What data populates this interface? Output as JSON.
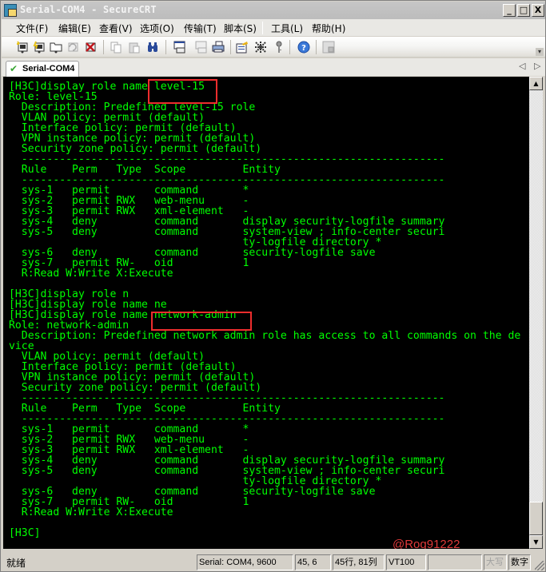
{
  "window": {
    "title": "Serial-COM4 - SecureCRT",
    "controls": {
      "minimize": "_",
      "maximize": "□",
      "close": "X"
    }
  },
  "menu": {
    "items": [
      {
        "label": "文件(F)"
      },
      {
        "label": "编辑(E)"
      },
      {
        "label": "查看(V)"
      },
      {
        "label": "选项(O)"
      },
      {
        "label": "传输(T)"
      },
      {
        "label": "脚本(S)"
      },
      {
        "label": "工具(L)"
      },
      {
        "label": "帮助(H)"
      }
    ]
  },
  "toolbar": {
    "buttons": [
      {
        "icon": "connect-icon",
        "enabled": true
      },
      {
        "icon": "quick-connect-icon",
        "enabled": true
      },
      {
        "icon": "connect-in-tab-icon",
        "enabled": true
      },
      {
        "icon": "reconnect-icon",
        "enabled": false
      },
      {
        "icon": "disconnect-icon",
        "enabled": true
      },
      {
        "icon": "copy-icon",
        "enabled": false
      },
      {
        "icon": "paste-icon",
        "enabled": false
      },
      {
        "icon": "find-icon",
        "enabled": true
      },
      {
        "icon": "print-screen-icon",
        "enabled": true
      },
      {
        "icon": "print-selection-icon",
        "enabled": false
      },
      {
        "icon": "print-icon",
        "enabled": true
      },
      {
        "icon": "session-options-icon",
        "enabled": true
      },
      {
        "icon": "global-options-icon",
        "enabled": true
      },
      {
        "icon": "key-icon",
        "enabled": true
      },
      {
        "icon": "help-icon",
        "enabled": true
      },
      {
        "icon": "lock-session-icon",
        "enabled": false
      }
    ],
    "overflow": "▾"
  },
  "tabs": [
    {
      "label": "Serial-COM4",
      "active": true,
      "status": "connected"
    }
  ],
  "tab_nav": {
    "prev": "◁",
    "next": "▷"
  },
  "terminal": {
    "lines": [
      "[H3C]display role name level-15",
      "Role: level-15",
      "  Description: Predefined level-15 role",
      "  VLAN policy: permit (default)",
      "  Interface policy: permit (default)",
      "  VPN instance policy: permit (default)",
      "  Security zone policy: permit (default)",
      "  -------------------------------------------------------------------",
      "  Rule    Perm   Type  Scope         Entity",
      "  -------------------------------------------------------------------",
      "  sys-1   permit       command       *",
      "  sys-2   permit RWX   web-menu      -",
      "  sys-3   permit RWX   xml-element   -",
      "  sys-4   deny         command       display security-logfile summary",
      "  sys-5   deny         command       system-view ; info-center securi",
      "                                     ty-logfile directory *",
      "  sys-6   deny         command       security-logfile save",
      "  sys-7   permit RW-   oid           1",
      "  R:Read W:Write X:Execute",
      "",
      "[H3C]display role n",
      "[H3C]display role name ne",
      "[H3C]display role name network-admin",
      "Role: network-admin",
      "  Description: Predefined network admin role has access to all commands on the de",
      "vice",
      "  VLAN policy: permit (default)",
      "  Interface policy: permit (default)",
      "  VPN instance policy: permit (default)",
      "  Security zone policy: permit (default)",
      "  -------------------------------------------------------------------",
      "  Rule    Perm   Type  Scope         Entity",
      "  -------------------------------------------------------------------",
      "  sys-1   permit       command       *",
      "  sys-2   permit RWX   web-menu      -",
      "  sys-3   permit RWX   xml-element   -",
      "  sys-4   deny         command       display security-logfile summary",
      "  sys-5   deny         command       system-view ; info-center securi",
      "                                     ty-logfile directory *",
      "  sys-6   deny         command       security-logfile save",
      "  sys-7   permit RW-   oid           1",
      "  R:Read W:Write X:Execute",
      "",
      "[H3C]"
    ],
    "highlights": [
      {
        "text": "level-15",
        "line": 0
      },
      {
        "text": "network-admin",
        "line": 22
      }
    ],
    "colors": {
      "foreground": "#00ff00",
      "background": "#000000",
      "highlight": "#ee2d2d"
    },
    "watermark": "@Rog91222"
  },
  "statusbar": {
    "ready": "就绪",
    "connection": "Serial: COM4, 9600",
    "cursor": "45,  6",
    "size": "45行, 81列",
    "emulation": "VT100",
    "blank": "",
    "caps": "大写",
    "num": "数字"
  }
}
